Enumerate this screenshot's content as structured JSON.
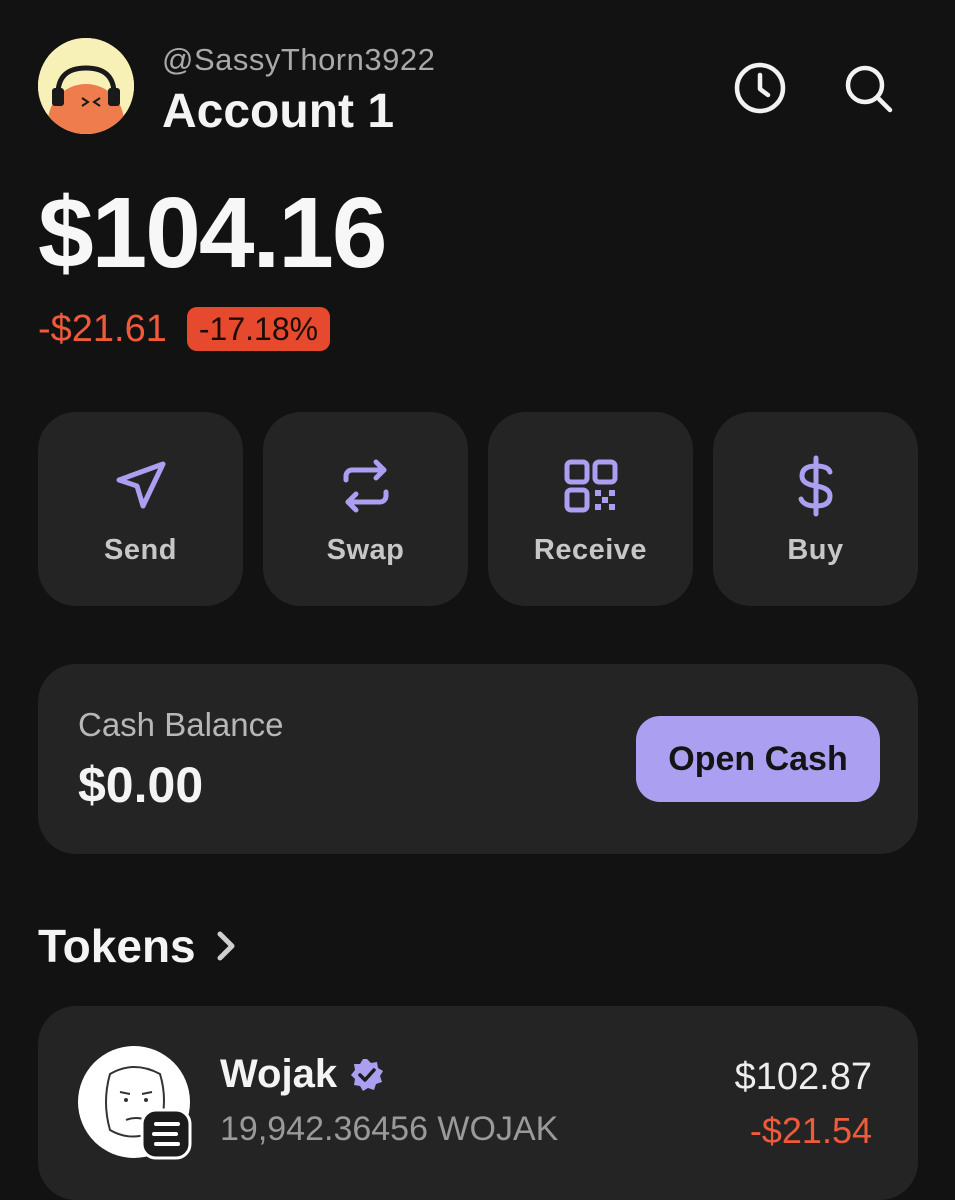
{
  "header": {
    "username": "@SassyThorn3922",
    "account_name": "Account 1",
    "avatar_icon": "avatar-headphones-face",
    "history_icon": "clock-icon",
    "search_icon": "search-icon"
  },
  "portfolio": {
    "balance": "$104.16",
    "change_amount": "-$21.61",
    "change_percent": "-17.18%"
  },
  "actions": [
    {
      "label": "Send",
      "icon": "send-icon"
    },
    {
      "label": "Swap",
      "icon": "swap-icon"
    },
    {
      "label": "Receive",
      "icon": "qr-code-icon"
    },
    {
      "label": "Buy",
      "icon": "dollar-icon"
    }
  ],
  "cash": {
    "label": "Cash Balance",
    "value": "$0.00",
    "button_label": "Open Cash"
  },
  "tokens": {
    "title": "Tokens",
    "items": [
      {
        "name": "Wojak",
        "verified": true,
        "amount": "19,942.36456 WOJAK",
        "usd_value": "$102.87",
        "change": "-$21.54",
        "logo_icon": "wojak-logo"
      }
    ]
  },
  "colors": {
    "background": "#121212",
    "card": "#242424",
    "accent": "#ab9ff2",
    "negative": "#ef5b3a",
    "badge": "#e6492d"
  }
}
